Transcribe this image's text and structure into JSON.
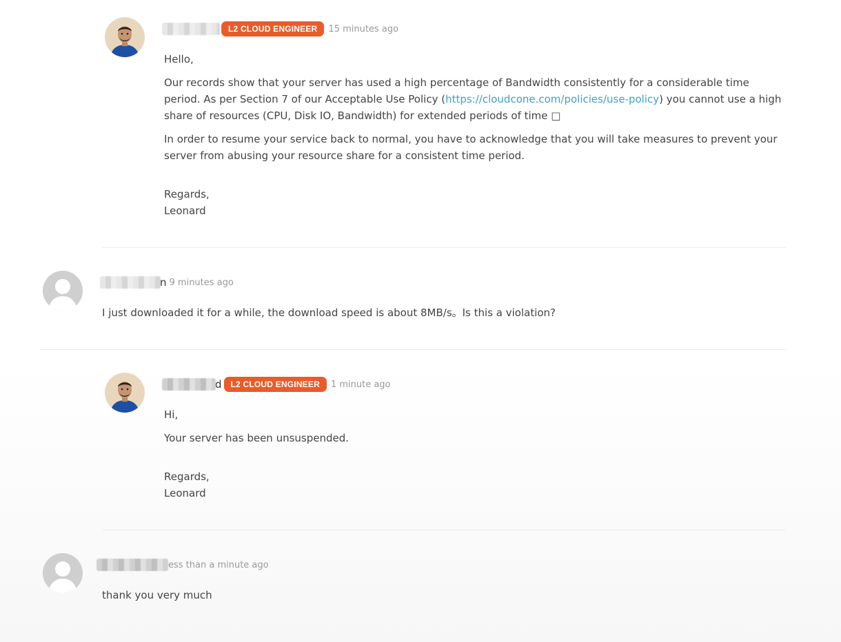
{
  "messages": [
    {
      "author_tail": "",
      "badge": "L2 CLOUD ENGINEER",
      "time": "15 minutes ago",
      "greeting": "Hello,",
      "para1_a": "Our records show that your server has used a high percentage of Bandwidth consistently for a considerable time period. As per Section 7 of our Acceptable Use Policy (",
      "para1_link": "https://cloudcone.com/policies/use-policy",
      "para1_b": ") you cannot use a high share of resources (CPU, Disk IO, Bandwidth) for extended periods of time □",
      "para2": "In order to resume your service back to normal, you have to acknowledge that you will take measures to prevent your server from abusing your resource share for a consistent time period.",
      "sign1": "Regards,",
      "sign2": "Leonard"
    },
    {
      "author_tail": "n",
      "time": "9 minutes ago",
      "text": "I just downloaded it for a while, the download speed is about 8MB/s。Is this a violation?"
    },
    {
      "author_tail": "d",
      "badge": "L2 CLOUD ENGINEER",
      "time": "1 minute ago",
      "greeting": "Hi,",
      "para1": "Your server has been unsuspended.",
      "sign1": "Regards,",
      "sign2": "Leonard"
    },
    {
      "author_tail": "",
      "time": "ess than a minute ago",
      "text": "thank you very much"
    }
  ],
  "icons": {
    "staff_avatar": "staff-photo-avatar",
    "user_avatar": "default-user-avatar"
  },
  "colors": {
    "badge": "#ea5b2a",
    "link": "#3fa0c9",
    "text": "#444444",
    "muted": "#999999"
  }
}
